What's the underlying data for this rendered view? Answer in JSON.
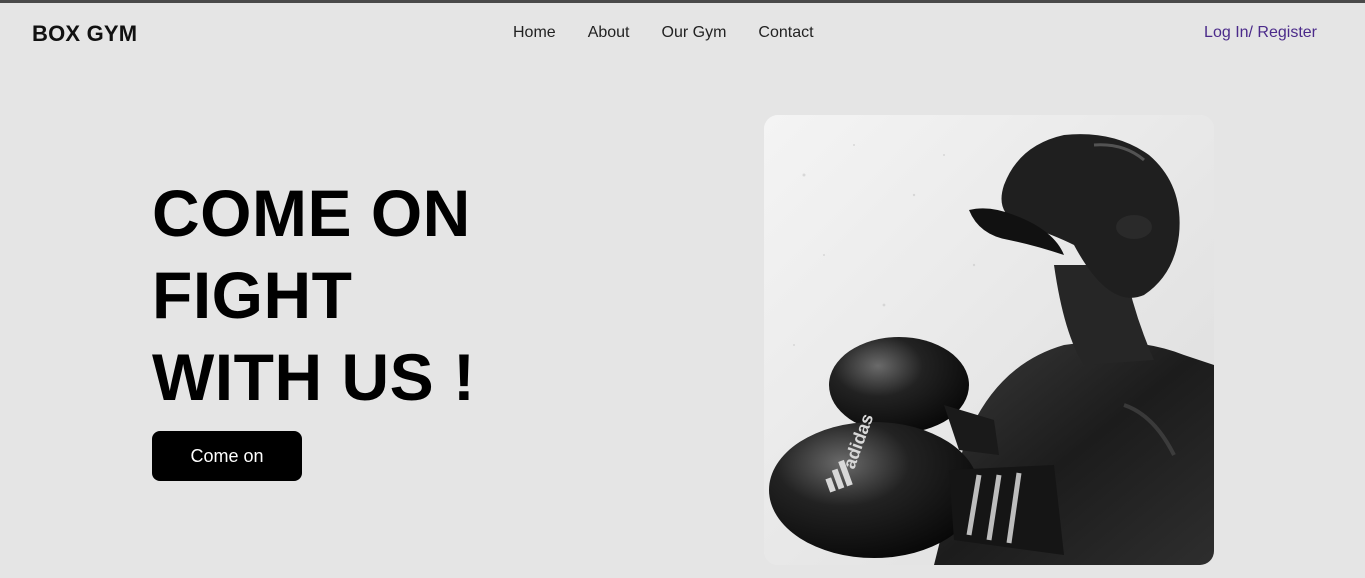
{
  "brand": "BOX GYM",
  "nav": {
    "items": [
      "Home",
      "About",
      "Our Gym",
      "Contact"
    ],
    "login": "Log In/ Register"
  },
  "hero": {
    "title_lines": [
      "COME ON",
      "FIGHT",
      "WITH US !"
    ],
    "cta_label": "Come on",
    "image_glove_text": "adidas"
  },
  "colors": {
    "background": "#e5e5e5",
    "accent_link": "#4b2a8a",
    "cta_bg": "#000000"
  }
}
